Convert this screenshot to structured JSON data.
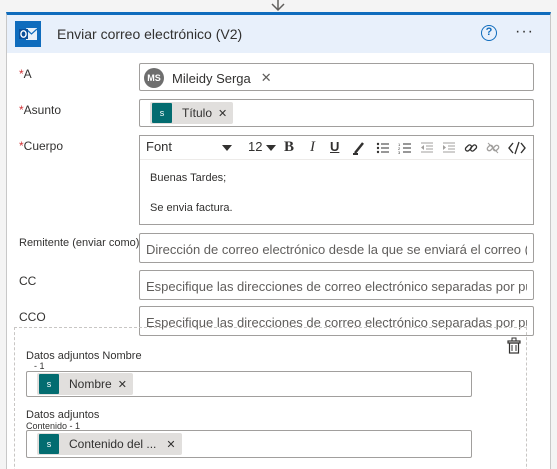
{
  "header": {
    "title": "Enviar correo electrónico (V2)",
    "help_icon": "?",
    "more_icon": "···"
  },
  "fields": {
    "to": {
      "label": "A",
      "required": "*",
      "persona_initials": "MS",
      "persona_name": "Mileidy Serga",
      "remove": "✕"
    },
    "subject": {
      "label": "Asunto",
      "required": "*",
      "token": "Título",
      "token_icon": "s",
      "remove": "✕"
    },
    "body": {
      "label": "Cuerpo",
      "required": "*",
      "toolbar": {
        "font": "Font",
        "size": "12",
        "bold": "B",
        "italic": "I",
        "underline": "U"
      },
      "lines": [
        "Buenas Tardes;",
        "Se envia factura."
      ]
    },
    "from": {
      "label": "Remitente (enviar como)",
      "placeholder": "Dirección de correo electrónico desde la que se enviará el correo (r..."
    },
    "cc": {
      "label": "CC",
      "placeholder": "Especifique las direcciones de correo electrónico separadas por pu..."
    },
    "bcc": {
      "label": "CCO",
      "placeholder": "Especifique las direcciones de correo electrónico separadas por pu..."
    },
    "attachments": {
      "name_label": "Datos adjuntos Nombre",
      "name_sub": "- 1",
      "name_token": "Nombre",
      "content_label": "Datos adjuntos",
      "content_sub": "Contenido - 1",
      "content_token": "Contenido del ...",
      "token_icon": "s",
      "remove": "✕"
    }
  },
  "colors": {
    "accent": "#0f6cbd",
    "header_bg": "#e8f0fb",
    "sharepoint": "#036c70",
    "required": "#d13438"
  }
}
